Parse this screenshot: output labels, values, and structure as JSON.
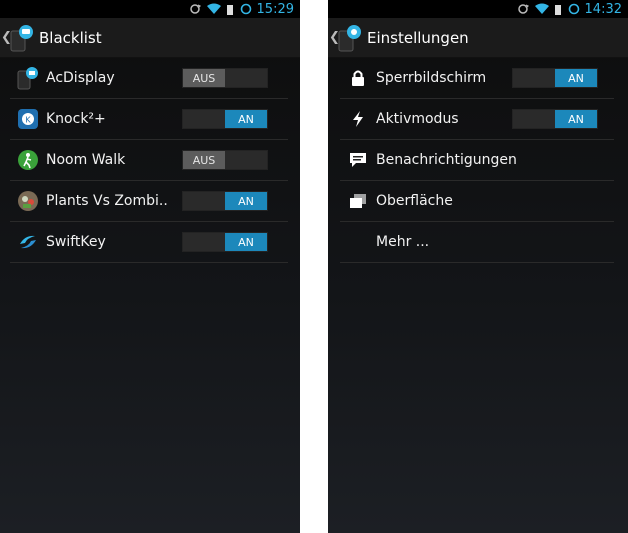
{
  "left": {
    "status": {
      "time": "15:29"
    },
    "header": {
      "title": "Blacklist"
    },
    "items": [
      {
        "label": "AcDisplay",
        "toggle": "AUS"
      },
      {
        "label": "Knock²+",
        "toggle": "AN"
      },
      {
        "label": "Noom Walk",
        "toggle": "AUS"
      },
      {
        "label": "Plants Vs Zombi..",
        "toggle": "AN"
      },
      {
        "label": "SwiftKey",
        "toggle": "AN"
      }
    ]
  },
  "right": {
    "status": {
      "time": "14:32"
    },
    "header": {
      "title": "Einstellungen"
    },
    "items": [
      {
        "label": "Sperrbildschirm",
        "toggle": "AN",
        "icon": "lock-icon"
      },
      {
        "label": "Aktivmodus",
        "toggle": "AN",
        "icon": "lightning-icon"
      },
      {
        "label": "Benachrichtigungen",
        "icon": "notification-icon"
      },
      {
        "label": "Oberfläche",
        "icon": "layers-icon"
      },
      {
        "label": "Mehr ..."
      }
    ]
  },
  "colors": {
    "accent": "#33b5e5",
    "toggle_on": "#1c88bb",
    "toggle_off": "#5c5c5c"
  }
}
